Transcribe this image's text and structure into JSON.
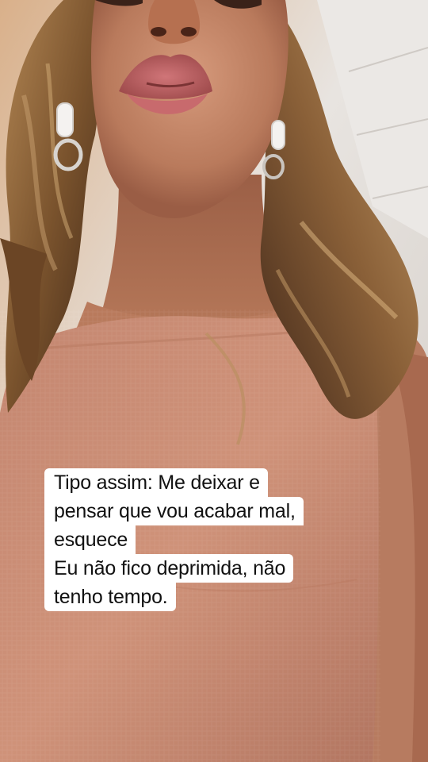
{
  "caption": {
    "lines": [
      "Tipo assim: Me deixar e",
      "pensar que vou acabar mal,",
      "esquece",
      "Eu não fico deprimida, não",
      "tenho tempo."
    ]
  },
  "colors": {
    "caption_background": "#ffffff",
    "caption_text": "#111111",
    "top_background": "#e6e2de",
    "top_shade": "#8c7c6c",
    "skin": "#c48566",
    "skin_dark": "#a86448",
    "hair": "#8a6236",
    "hair_dark": "#4a2f1c",
    "top_garment": "#c98c72",
    "top_garment_dark": "#a66d57",
    "lips": "#b8585a"
  },
  "icons": [
    "earring-hoop-left",
    "earring-hoop-right"
  ]
}
